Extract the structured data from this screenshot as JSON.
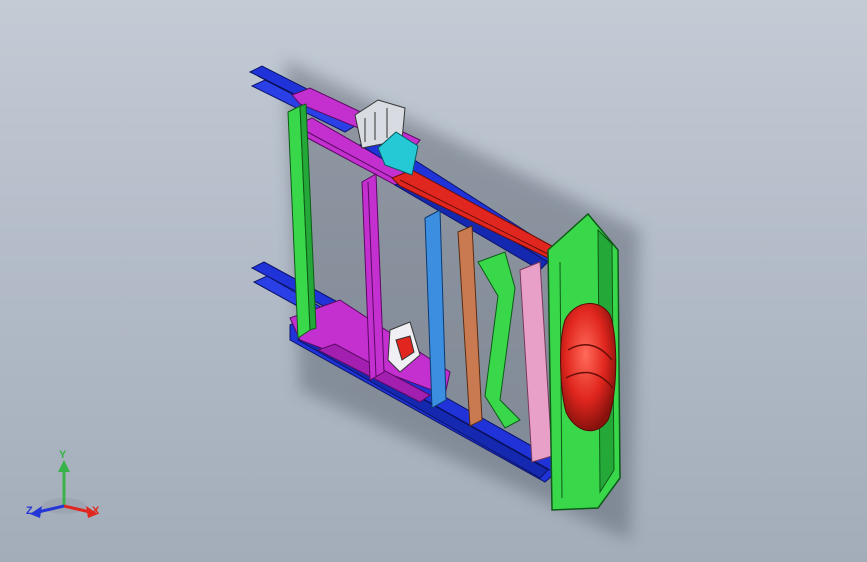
{
  "viewport": {
    "background_top": "#c3cbd5",
    "background_bottom": "#a3adba"
  },
  "model": {
    "part_colors": {
      "rail_blue": "#1f33d8",
      "member_magenta": "#c42fd0",
      "bracket_green": "#39d84a",
      "beam_red": "#e0261e",
      "post_orange": "#c97a50",
      "post_pink": "#e9a0c8",
      "strut_light_blue": "#3c8ee0",
      "bracket_cyan": "#25c9d6",
      "component_grey": "#d9dbe2"
    }
  },
  "triad": {
    "y_label": "Y",
    "x_label": "X",
    "z_label": "Z",
    "y_color": "#38b34a",
    "x_color": "#e0261e",
    "z_color": "#2437d6"
  }
}
